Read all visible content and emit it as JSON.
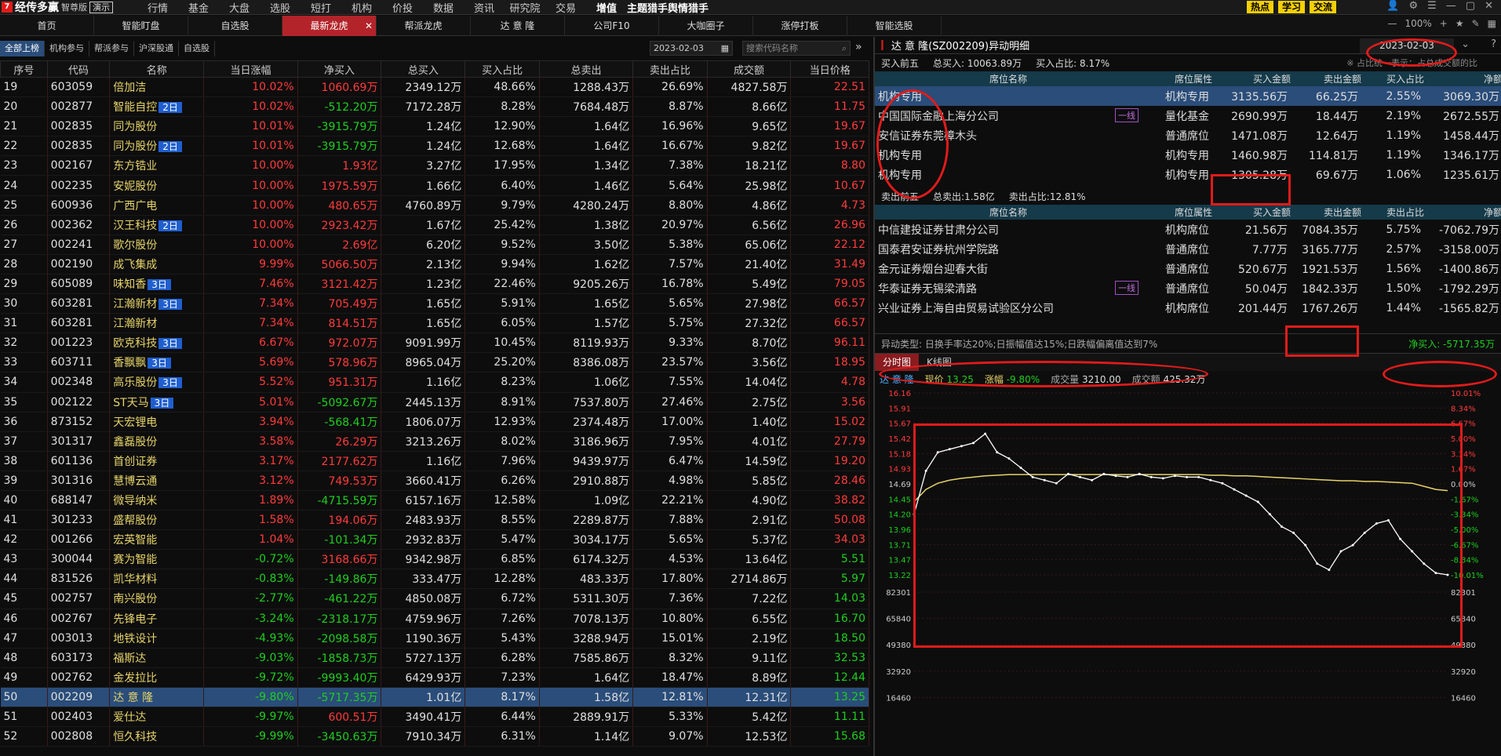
{
  "app": {
    "name": "经传多赢",
    "edition": "智尊版",
    "demo": "演示"
  },
  "menu": [
    "行情",
    "基金",
    "大盘",
    "选股",
    "短打",
    "机构",
    "价投",
    "数据",
    "资讯",
    "研究院",
    "交易",
    "增值",
    "主题猎手",
    "舆情猎手"
  ],
  "top_buttons": [
    "热点",
    "学习",
    "交流"
  ],
  "zoom": "100%",
  "tabs": [
    "首页",
    "智能盯盘",
    "自选股",
    "最新龙虎",
    "帮派龙虎",
    "达 意 隆",
    "公司F10",
    "大咖圈子",
    "涨停打板",
    "智能选股"
  ],
  "active_tab": "最新龙虎",
  "sub_tabs": [
    "全部上榜",
    "机构参与",
    "帮派参与",
    "沪深股通",
    "自选股"
  ],
  "date": "2023-02-03",
  "search_placeholder": "搜索代码名称",
  "columns": [
    "序号",
    "代码",
    "名称",
    "当日涨幅",
    "净买入",
    "总买入",
    "买入占比",
    "总卖出",
    "卖出占比",
    "成交额",
    "当日价格"
  ],
  "rows": [
    [
      "19",
      "603059",
      "倍加洁",
      "",
      "10.02%",
      "1060.69万",
      "2349.12万",
      "48.66%",
      "1288.43万",
      "26.69%",
      "4827.58万",
      "22.51"
    ],
    [
      "20",
      "002877",
      "智能自控",
      "2日",
      "10.02%",
      "-512.20万",
      "7172.28万",
      "8.28%",
      "7684.48万",
      "8.87%",
      "8.66亿",
      "11.75"
    ],
    [
      "21",
      "002835",
      "同为股份",
      "",
      "10.01%",
      "-3915.79万",
      "1.24亿",
      "12.90%",
      "1.64亿",
      "16.96%",
      "9.65亿",
      "19.67"
    ],
    [
      "22",
      "002835",
      "同为股份",
      "2日",
      "10.01%",
      "-3915.79万",
      "1.24亿",
      "12.68%",
      "1.64亿",
      "16.67%",
      "9.82亿",
      "19.67"
    ],
    [
      "23",
      "002167",
      "东方锆业",
      "",
      "10.00%",
      "1.93亿",
      "3.27亿",
      "17.95%",
      "1.34亿",
      "7.38%",
      "18.21亿",
      "8.80"
    ],
    [
      "24",
      "002235",
      "安妮股份",
      "",
      "10.00%",
      "1975.59万",
      "1.66亿",
      "6.40%",
      "1.46亿",
      "5.64%",
      "25.98亿",
      "10.67"
    ],
    [
      "25",
      "600936",
      "广西广电",
      "",
      "10.00%",
      "480.65万",
      "4760.89万",
      "9.79%",
      "4280.24万",
      "8.80%",
      "4.86亿",
      "4.73"
    ],
    [
      "26",
      "002362",
      "汉王科技",
      "2日",
      "10.00%",
      "2923.42万",
      "1.67亿",
      "25.42%",
      "1.38亿",
      "20.97%",
      "6.56亿",
      "26.96"
    ],
    [
      "27",
      "002241",
      "歌尔股份",
      "",
      "10.00%",
      "2.69亿",
      "6.20亿",
      "9.52%",
      "3.50亿",
      "5.38%",
      "65.06亿",
      "22.12"
    ],
    [
      "28",
      "002190",
      "成飞集成",
      "",
      "9.99%",
      "5066.50万",
      "2.13亿",
      "9.94%",
      "1.62亿",
      "7.57%",
      "21.40亿",
      "31.49"
    ],
    [
      "29",
      "605089",
      "味知香",
      "3日",
      "7.46%",
      "3121.42万",
      "1.23亿",
      "22.46%",
      "9205.26万",
      "16.78%",
      "5.49亿",
      "79.05"
    ],
    [
      "30",
      "603281",
      "江瀚新材",
      "3日",
      "7.34%",
      "705.49万",
      "1.65亿",
      "5.91%",
      "1.65亿",
      "5.65%",
      "27.98亿",
      "66.57"
    ],
    [
      "31",
      "603281",
      "江瀚新材",
      "",
      "7.34%",
      "814.51万",
      "1.65亿",
      "6.05%",
      "1.57亿",
      "5.75%",
      "27.32亿",
      "66.57"
    ],
    [
      "32",
      "001223",
      "欧克科技",
      "3日",
      "6.67%",
      "972.07万",
      "9091.99万",
      "10.45%",
      "8119.93万",
      "9.33%",
      "8.70亿",
      "96.11"
    ],
    [
      "33",
      "603711",
      "香飘飘",
      "3日",
      "5.69%",
      "578.96万",
      "8965.04万",
      "25.20%",
      "8386.08万",
      "23.57%",
      "3.56亿",
      "18.95"
    ],
    [
      "34",
      "002348",
      "高乐股份",
      "3日",
      "5.52%",
      "951.31万",
      "1.16亿",
      "8.23%",
      "1.06亿",
      "7.55%",
      "14.04亿",
      "4.78"
    ],
    [
      "35",
      "002122",
      "ST天马",
      "3日",
      "5.01%",
      "-5092.67万",
      "2445.13万",
      "8.91%",
      "7537.80万",
      "27.46%",
      "2.75亿",
      "3.56"
    ],
    [
      "36",
      "873152",
      "天宏锂电",
      "",
      "3.94%",
      "-568.41万",
      "1806.07万",
      "12.93%",
      "2374.48万",
      "17.00%",
      "1.40亿",
      "15.02"
    ],
    [
      "37",
      "301317",
      "鑫磊股份",
      "",
      "3.58%",
      "26.29万",
      "3213.26万",
      "8.02%",
      "3186.96万",
      "7.95%",
      "4.01亿",
      "27.79"
    ],
    [
      "38",
      "601136",
      "首创证券",
      "",
      "3.17%",
      "2177.62万",
      "1.16亿",
      "7.96%",
      "9439.97万",
      "6.47%",
      "14.59亿",
      "19.20"
    ],
    [
      "39",
      "301316",
      "慧博云通",
      "",
      "3.12%",
      "749.53万",
      "3660.41万",
      "6.26%",
      "2910.88万",
      "4.98%",
      "5.85亿",
      "28.46"
    ],
    [
      "40",
      "688147",
      "微导纳米",
      "",
      "1.89%",
      "-4715.59万",
      "6157.16万",
      "12.58%",
      "1.09亿",
      "22.21%",
      "4.90亿",
      "38.82"
    ],
    [
      "41",
      "301233",
      "盛帮股份",
      "",
      "1.58%",
      "194.06万",
      "2483.93万",
      "8.55%",
      "2289.87万",
      "7.88%",
      "2.91亿",
      "50.08"
    ],
    [
      "42",
      "001266",
      "宏英智能",
      "",
      "1.04%",
      "-101.34万",
      "2932.83万",
      "5.47%",
      "3034.17万",
      "5.65%",
      "5.37亿",
      "34.03"
    ],
    [
      "43",
      "300044",
      "赛为智能",
      "",
      "-0.72%",
      "3168.66万",
      "9342.98万",
      "6.85%",
      "6174.32万",
      "4.53%",
      "13.64亿",
      "5.51"
    ],
    [
      "44",
      "831526",
      "凯华材料",
      "",
      "-0.83%",
      "-149.86万",
      "333.47万",
      "12.28%",
      "483.33万",
      "17.80%",
      "2714.86万",
      "5.97"
    ],
    [
      "45",
      "002757",
      "南兴股份",
      "",
      "-2.77%",
      "-461.22万",
      "4850.08万",
      "6.72%",
      "5311.30万",
      "7.36%",
      "7.22亿",
      "14.03"
    ],
    [
      "46",
      "002767",
      "先锋电子",
      "",
      "-3.24%",
      "-2318.17万",
      "4759.96万",
      "7.26%",
      "7078.13万",
      "10.80%",
      "6.55亿",
      "16.70"
    ],
    [
      "47",
      "003013",
      "地铁设计",
      "",
      "-4.93%",
      "-2098.58万",
      "1190.36万",
      "5.43%",
      "3288.94万",
      "15.01%",
      "2.19亿",
      "18.50"
    ],
    [
      "48",
      "603173",
      "福斯达",
      "",
      "-9.03%",
      "-1858.73万",
      "5727.13万",
      "6.28%",
      "7585.86万",
      "8.32%",
      "9.11亿",
      "32.53"
    ],
    [
      "49",
      "002762",
      "金发拉比",
      "",
      "-9.72%",
      "-9993.40万",
      "6429.93万",
      "7.23%",
      "1.64亿",
      "18.47%",
      "8.89亿",
      "12.44"
    ],
    [
      "50",
      "002209",
      "达 意 隆",
      "",
      "-9.80%",
      "-5717.35万",
      "1.01亿",
      "8.17%",
      "1.58亿",
      "12.81%",
      "12.31亿",
      "13.25"
    ],
    [
      "51",
      "002403",
      "爱仕达",
      "",
      "-9.97%",
      "600.51万",
      "3490.41万",
      "6.44%",
      "2889.91万",
      "5.33%",
      "5.42亿",
      "11.11"
    ],
    [
      "52",
      "002808",
      "恒久科技",
      "",
      "-9.99%",
      "-3450.63万",
      "7910.34万",
      "6.31%",
      "1.14亿",
      "9.07%",
      "12.53亿",
      "15.68"
    ]
  ],
  "detail": {
    "title": "达 意 隆(SZ002209)异动明细",
    "buy_label": "买入前五",
    "buy_total": "总买入: 10063.89万",
    "buy_ratio": "买入占比: 8.17%",
    "note": "※ 占比统一表示：占总成交额的比",
    "seat_cols_buy": [
      "席位名称",
      "席位属性",
      "买入金额",
      "卖出金额",
      "买入占比",
      "净额"
    ],
    "buy_rows": [
      [
        "机构专用",
        "",
        "机构专用",
        "3135.56万",
        "66.25万",
        "2.55%",
        "3069.30万"
      ],
      [
        "中国国际金融上海分公司",
        "一线",
        "量化基金",
        "2690.99万",
        "18.44万",
        "2.19%",
        "2672.55万"
      ],
      [
        "安信证券东莞樟木头",
        "",
        "普通席位",
        "1471.08万",
        "12.64万",
        "1.19%",
        "1458.44万"
      ],
      [
        "机构专用",
        "",
        "机构专用",
        "1460.98万",
        "114.81万",
        "1.19%",
        "1346.17万"
      ],
      [
        "机构专用",
        "",
        "机构专用",
        "1305.28万",
        "69.67万",
        "1.06%",
        "1235.61万"
      ]
    ],
    "sell_label": "卖出前五",
    "sell_total": "总卖出:1.58亿",
    "sell_ratio": "卖出占比:12.81%",
    "seat_cols_sell": [
      "席位名称",
      "席位属性",
      "买入金额",
      "卖出金额",
      "卖出占比",
      "净额"
    ],
    "sell_rows": [
      [
        "中信建投证券甘肃分公司",
        "",
        "机构席位",
        "21.56万",
        "7084.35万",
        "5.75%",
        "-7062.79万"
      ],
      [
        "国泰君安证券杭州学院路",
        "",
        "普通席位",
        "7.77万",
        "3165.77万",
        "2.57%",
        "-3158.00万"
      ],
      [
        "金元证券烟台迎春大街",
        "",
        "普通席位",
        "520.67万",
        "1921.53万",
        "1.56%",
        "-1400.86万"
      ],
      [
        "华泰证券无锡梁清路",
        "一线",
        "普通席位",
        "50.04万",
        "1842.33万",
        "1.50%",
        "-1792.29万"
      ],
      [
        "兴业证券上海自由贸易试验区分公司",
        "",
        "机构席位",
        "201.44万",
        "1767.26万",
        "1.44%",
        "-1565.82万"
      ]
    ],
    "alert": "异动类型: 日换手率达20%;日振幅值达15%;日跌幅偏离值达到7%",
    "net_buy": "净买入: -5717.35万",
    "chart_tabs": [
      "分时图",
      "K线图"
    ],
    "chart_info": {
      "name": "达 意 隆",
      "price_label": "现价",
      "price": "13.25",
      "chg_label": "涨幅",
      "chg": "-9.80%",
      "vol_label": "成交量",
      "vol": "3210.00",
      "amt_label": "成交额",
      "amt": "425.32万"
    }
  },
  "chart_data": {
    "type": "line",
    "title": "",
    "y_left": [
      "16.16",
      "15.91",
      "15.67",
      "15.42",
      "15.18",
      "14.93",
      "14.69",
      "14.45",
      "14.20",
      "13.96",
      "13.71",
      "13.47",
      "13.22"
    ],
    "y_right": [
      "10.01%",
      "8.34%",
      "6.67%",
      "5.00%",
      "3.34%",
      "1.67%",
      "0.00%",
      "-1.67%",
      "-3.34%",
      "-5.00%",
      "-6.67%",
      "-8.34%",
      "-10.01%"
    ],
    "ylim": [
      13.22,
      16.16
    ],
    "price": [
      14.2,
      14.9,
      15.2,
      15.25,
      15.3,
      15.35,
      15.5,
      15.2,
      15.1,
      14.95,
      14.8,
      14.75,
      14.7,
      14.85,
      14.8,
      14.75,
      14.85,
      14.82,
      14.8,
      14.85,
      14.8,
      14.78,
      14.82,
      14.8,
      14.8,
      14.75,
      14.7,
      14.6,
      14.5,
      14.4,
      14.2,
      14.0,
      13.9,
      13.7,
      13.4,
      13.3,
      13.6,
      13.7,
      13.9,
      14.05,
      14.1,
      13.8,
      13.6,
      13.4,
      13.25,
      13.22
    ],
    "avg": [
      14.4,
      14.6,
      14.7,
      14.75,
      14.78,
      14.8,
      14.82,
      14.83,
      14.84,
      14.84,
      14.84,
      14.84,
      14.84,
      14.84,
      14.84,
      14.84,
      14.84,
      14.84,
      14.84,
      14.84,
      14.84,
      14.84,
      14.84,
      14.84,
      14.84,
      14.83,
      14.83,
      14.82,
      14.82,
      14.81,
      14.8,
      14.79,
      14.78,
      14.77,
      14.76,
      14.75,
      14.74,
      14.74,
      14.73,
      14.73,
      14.72,
      14.71,
      14.7,
      14.65,
      14.6,
      14.58
    ],
    "vol_ticks": [
      "82301",
      "65840",
      "49380",
      "32920",
      "16460"
    ]
  }
}
